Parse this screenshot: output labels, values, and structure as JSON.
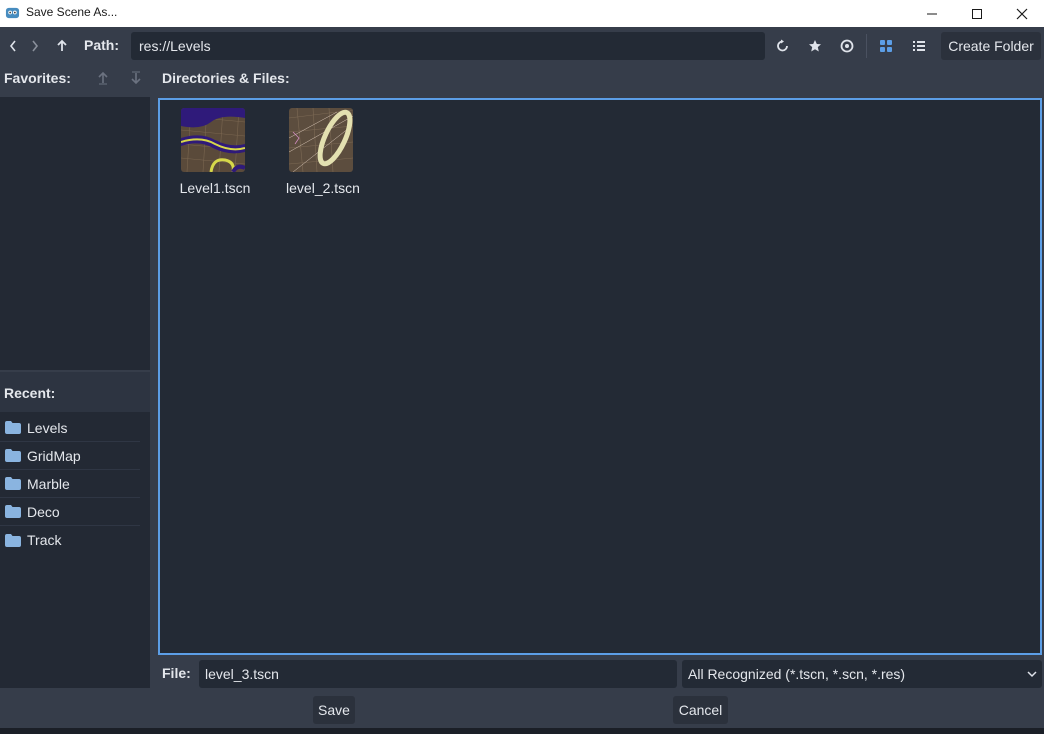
{
  "window": {
    "title": "Save Scene As...",
    "minimize_icon": "minimize-icon",
    "maximize_icon": "maximize-icon",
    "close_icon": "close-icon"
  },
  "toolbar": {
    "path_label": "Path:",
    "path_value": "res://Levels",
    "create_folder_label": "Create Folder",
    "icons": [
      "chevron-left-icon",
      "chevron-right-icon",
      "arrow-up-icon",
      "refresh-icon",
      "star-icon",
      "eye-icon",
      "grid-view-icon",
      "list-view-icon"
    ]
  },
  "favorites": {
    "label": "Favorites:"
  },
  "recent": {
    "label": "Recent:",
    "items": [
      {
        "label": "Levels"
      },
      {
        "label": "GridMap"
      },
      {
        "label": "Marble"
      },
      {
        "label": "Deco"
      },
      {
        "label": "Track"
      }
    ]
  },
  "files": {
    "label": "Directories & Files:",
    "items": [
      {
        "name": "Level1.tscn"
      },
      {
        "name": "level_2.tscn"
      }
    ]
  },
  "footer": {
    "file_label": "File:",
    "file_value": "level_3.tscn",
    "filter_value": "All Recognized (*.tscn, *.scn, *.res)",
    "save_label": "Save",
    "cancel_label": "Cancel"
  },
  "colors": {
    "accent": "#5c9ee6",
    "panel_bg": "#363d4a",
    "input_bg": "#232a35"
  }
}
